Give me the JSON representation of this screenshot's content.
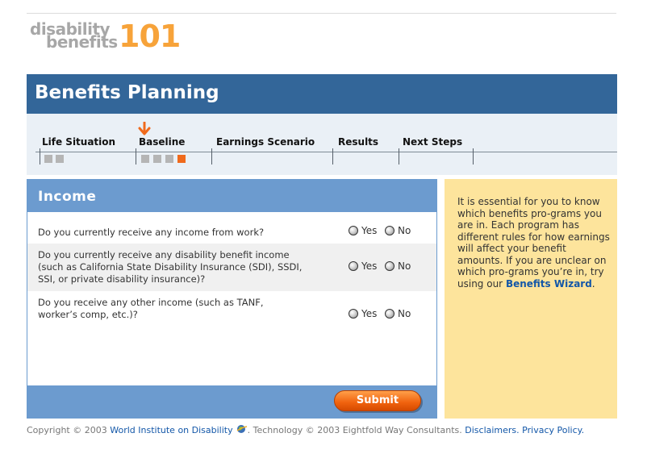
{
  "logo": {
    "line1": "disability",
    "line2": "benefits",
    "number": "101"
  },
  "banner": {
    "title": "Benefits Planning"
  },
  "steps": {
    "items": [
      {
        "label": "Life Situation"
      },
      {
        "label": "Baseline"
      },
      {
        "label": "Earnings Scenario"
      },
      {
        "label": "Results"
      },
      {
        "label": "Next Steps"
      }
    ],
    "current": "Baseline"
  },
  "income": {
    "title": "Income",
    "yes_label": "Yes",
    "no_label": "No",
    "questions": [
      {
        "text": "Do you currently receive any income from work?"
      },
      {
        "text": "Do you currently receive any disability benefit income (such as California State Disability Insurance (SDI), SSDI, SSI, or private disability insurance)?"
      },
      {
        "text": "Do you receive any other income (such as TANF, worker’s comp, etc.)?"
      }
    ],
    "submit_label": "Submit"
  },
  "side": {
    "text": "It is essential for you to know which benefits pro-grams you are in. Each program has different rules for how earnings will affect your benefit amounts. If you are unclear on which pro-grams you’re in, try using our",
    "link": "Benefits Wizard",
    "after": "."
  },
  "footer": {
    "copyright": "Copyright © 2003",
    "wid_link": "World Institute on Disability",
    "tech": ". Technology © 2003 Eightfold Way Consultants.",
    "disclaimers": "Disclaimers",
    "privacy": "Privacy Policy",
    "dot": "."
  },
  "colors": {
    "banner": "#336699",
    "panel_header": "#6c9bcf",
    "side_panel": "#fde49c",
    "accent_orange": "#f06a1c",
    "link": "#1357a8"
  }
}
